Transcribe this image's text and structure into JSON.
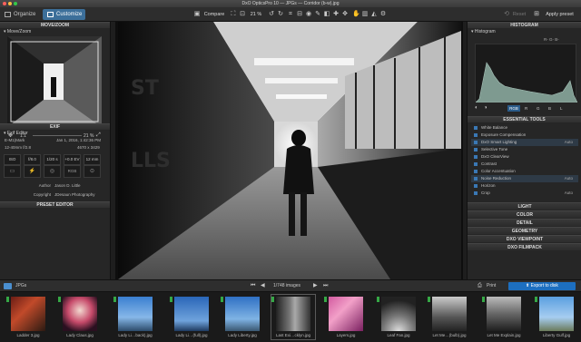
{
  "window": {
    "title": "DxO OpticsPro 10 — JPGs — Corridor (b-w).jpg"
  },
  "toolbar": {
    "tabs": [
      {
        "label": "Organize"
      },
      {
        "label": "Customize"
      }
    ],
    "compare_label": "Compare",
    "zoom_value": "21 %",
    "reset_label": "Reset",
    "apply_preset_label": "Apply preset"
  },
  "left_panel": {
    "move_zoom": {
      "header": "MOVE/ZOOM",
      "sub_header": "Move/Zoom",
      "ratio_label": "1:1",
      "zoom_value": "21 %"
    },
    "exif": {
      "header": "EXIF",
      "sub_header": "Exif Editor",
      "camera": "E-M1(Mark",
      "date": "Jan 1, 2016, 1:42:36 PM",
      "lens": "12-40mm f/2.8",
      "dimensions": "4670 x 3429",
      "iso": "ISO 2000",
      "aperture": "f/8.0",
      "shutter": "1/20 s",
      "ev": "+0.0 EV",
      "focal": "12 mm",
      "color": "RGB",
      "author_label": "Author",
      "author_value": "Jason D. Little",
      "copyright_label": "Copyright",
      "copyright_value": "JDesaun Photography"
    },
    "preset_editor": {
      "header": "PRESET EDITOR"
    }
  },
  "right_panel": {
    "histogram": {
      "header": "HISTOGRAM",
      "sub_header": "Histogram",
      "readout": "R-  G-  B-",
      "channels": [
        "RGB",
        "R",
        "G",
        "B",
        "L"
      ]
    },
    "essential_tools": {
      "header": "ESSENTIAL TOOLS",
      "items": [
        {
          "label": "White Balance",
          "value": ""
        },
        {
          "label": "Exposure Compensation",
          "value": ""
        },
        {
          "label": "DxO Smart Lighting",
          "value": "Auto"
        },
        {
          "label": "Selective Tone",
          "value": ""
        },
        {
          "label": "DxO ClearView",
          "value": ""
        },
        {
          "label": "Contrast",
          "value": ""
        },
        {
          "label": "Color Accentuation",
          "value": ""
        },
        {
          "label": "Noise Reduction",
          "value": "Auto"
        },
        {
          "label": "Horizon",
          "value": ""
        },
        {
          "label": "Crop",
          "value": "Auto"
        }
      ]
    },
    "sections": [
      "LIGHT",
      "COLOR",
      "DETAIL",
      "GEOMETRY",
      "DXO VIEWPOINT",
      "DXO FILMPACK"
    ]
  },
  "filmstrip_bar": {
    "folder_label": "JPGs",
    "image_count": "1/748 images",
    "print_label": "Print",
    "export_label": "Export to disk"
  },
  "filmstrip": [
    {
      "caption": "Ladder 3.jpg"
    },
    {
      "caption": "Lady Claus.jpg"
    },
    {
      "caption": "Lady Li…back).jpg"
    },
    {
      "caption": "Lady Li…(full).jpg"
    },
    {
      "caption": "Lady Liberty.jpg"
    },
    {
      "caption": "Last Exi…cklyn.jpg"
    },
    {
      "caption": "Layers.jpg"
    },
    {
      "caption": "Leaf Fan.jpg"
    },
    {
      "caption": "Let Me…(bulb).jpg"
    },
    {
      "caption": "Let Me Explain.jpg"
    },
    {
      "caption": "Liberty Gulf.jpg"
    }
  ],
  "colors": {
    "accent": "#1f6fb5",
    "export_button": "#1d6fc0",
    "flag_green": "#35a845",
    "panel_bg": "#262626"
  }
}
